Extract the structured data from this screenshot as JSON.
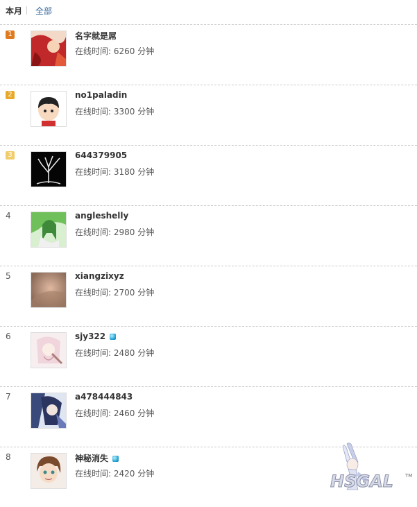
{
  "tabs": {
    "active": "本月",
    "other": "全部"
  },
  "online_label": "在线时间: ",
  "unit": " 分钟",
  "rank_colors": {
    "1": "#e07a1e",
    "2": "#e8a82a",
    "3": "#f0cc6a"
  },
  "users": [
    {
      "rank": "1",
      "name": "名字就是屌",
      "minutes": "6260",
      "verified": false,
      "avatar": "avatar-red-art-icon"
    },
    {
      "rank": "2",
      "name": "no1paladin",
      "minutes": "3300",
      "verified": false,
      "avatar": "avatar-cartoon-boy-icon"
    },
    {
      "rank": "3",
      "name": "644379905",
      "minutes": "3180",
      "verified": false,
      "avatar": "avatar-white-tree-icon"
    },
    {
      "rank": "4",
      "name": "angleshelly",
      "minutes": "2980",
      "verified": false,
      "avatar": "avatar-green-anime-icon"
    },
    {
      "rank": "5",
      "name": "xiangzixyz",
      "minutes": "2700",
      "verified": false,
      "avatar": "avatar-beige-blur-icon"
    },
    {
      "rank": "6",
      "name": "sjy322",
      "minutes": "2480",
      "verified": true,
      "avatar": "avatar-pale-anime-icon"
    },
    {
      "rank": "7",
      "name": "a478444843",
      "minutes": "2460",
      "verified": false,
      "avatar": "avatar-blue-anime-icon"
    },
    {
      "rank": "8",
      "name": "神秘消失",
      "minutes": "2420",
      "verified": true,
      "avatar": "avatar-brown-hair-icon"
    }
  ],
  "watermark": {
    "text": "HSGAL",
    "tm": "TM"
  }
}
